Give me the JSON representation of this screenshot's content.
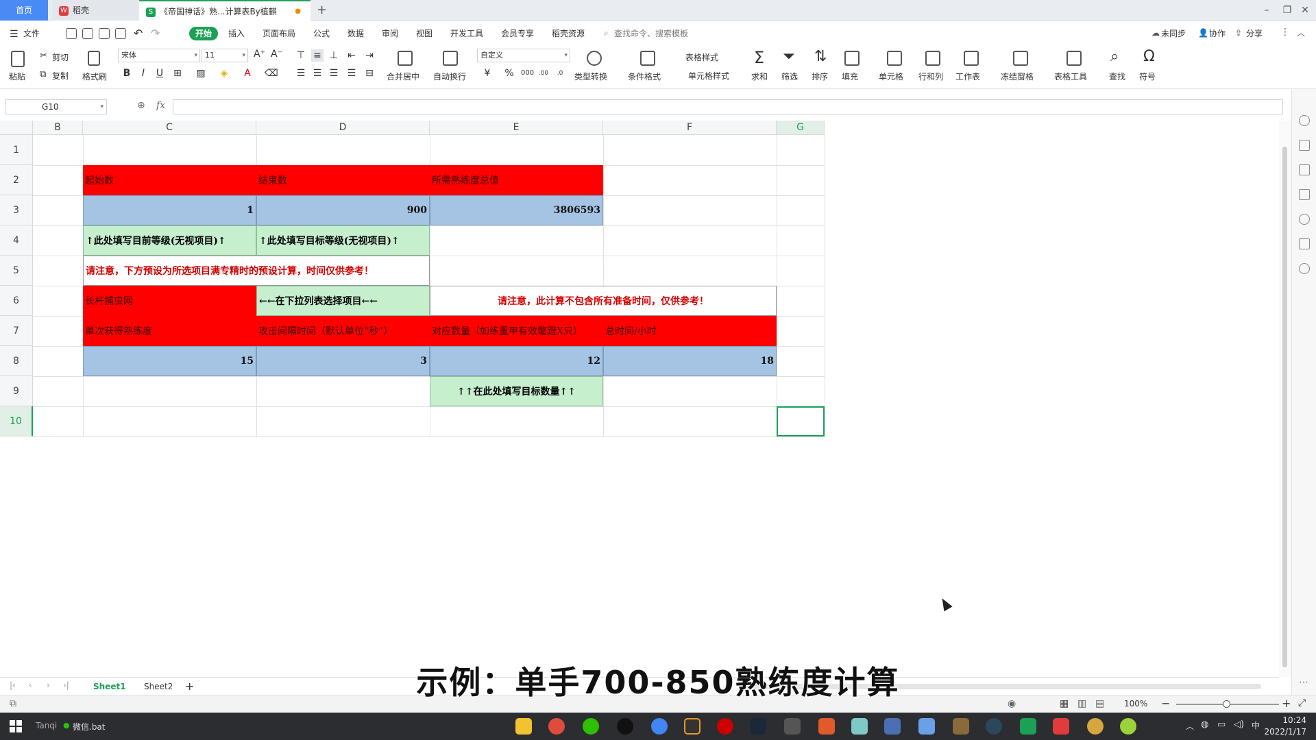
{
  "tabs": {
    "home": "首页",
    "wps_docs": "稻壳",
    "active_doc": "《帝国神话》熟...计算表By植麒"
  },
  "menu": {
    "file": "文件",
    "items": [
      "开始",
      "插入",
      "页面布局",
      "公式",
      "数据",
      "审阅",
      "视图",
      "开发工具",
      "会员专享",
      "稻壳资源"
    ],
    "search_placeholder": "查找命令、搜索模板",
    "right": [
      "未同步",
      "协作",
      "分享"
    ]
  },
  "ribbon": {
    "paste": "粘贴",
    "cut": "剪切",
    "copy": "复制",
    "format_painter": "格式刷",
    "font_name": "宋体",
    "font_size": "11",
    "merge": "合并居中",
    "wrap": "自动换行",
    "number_format": "自定义",
    "type_convert": "类型转换",
    "cond_format": "条件格式",
    "table_style": "表格样式",
    "cell_style": "单元格样式",
    "sum": "求和",
    "filter": "筛选",
    "sort": "排序",
    "fill": "填充",
    "cell": "单元格",
    "rowcol": "行和列",
    "worksheet": "工作表",
    "freeze": "冻结窗格",
    "table_tools": "表格工具",
    "find": "查找",
    "symbol": "符号"
  },
  "formula_bar": {
    "cell_ref": "G10",
    "fx": "fx",
    "content": ""
  },
  "columns": [
    "B",
    "C",
    "D",
    "E",
    "F",
    "G"
  ],
  "rows": [
    "1",
    "2",
    "3",
    "4",
    "5",
    "6",
    "7",
    "8",
    "9",
    "10"
  ],
  "cells": {
    "C2": "起始数",
    "D2": "结束数",
    "E2": "所需熟练度总值",
    "C3": "1",
    "D3": "900",
    "E3": "3806593",
    "C4": "↑此处填写目前等级(无视项目)↑",
    "D4": "↑此处填写目标等级(无视项目)↑",
    "C5": "请注意，下方预设为所选项目满专精时的预设计算，时间仅供参考！",
    "C6": "长杆捕虫网",
    "D6": "←←在下拉列表选择项目←←",
    "E6": "请注意，此计算不包含所有准备时间，仅供参考！",
    "C7": "单次获得熟练度",
    "D7": "攻击间隔时间（默认单位“秒”）",
    "E7": "对应数量（如练重甲有效氅蹬X只）",
    "F7": "总时间/小时",
    "C8": "15",
    "D8": "3",
    "E8": "12",
    "F8": "18",
    "E9": "↑↑在此处填写目标数量↑↑"
  },
  "sheets": [
    "Sheet1",
    "Sheet2"
  ],
  "status": {
    "zoom": "100%"
  },
  "subtitle": "示例：单手700-850熟练度计算",
  "taskbar": {
    "left_label": "Tanqi",
    "wechat_file": "微信.bat",
    "time": "10:24",
    "date": "2022/1/17"
  },
  "colors": {
    "accent": "#1ba156",
    "header_red": "#ff0000",
    "value_blue": "#a5c4e4",
    "hint_green": "#c6efce"
  }
}
